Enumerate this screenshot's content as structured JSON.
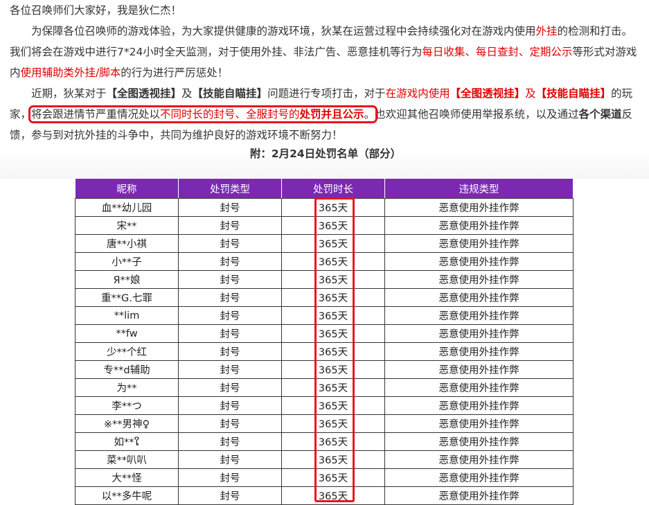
{
  "article": {
    "greeting": "各位召唤师们大家好，我是狄仁杰！",
    "p1_a": "为保障各位召唤师的游戏体验，为大家提供健康的游戏环境，狄某在运营过程中会持续强化对在游戏内使用",
    "p1_red1": "外挂",
    "p1_b": "的检测和打击。我们将会在游戏中进行7*24小时全天监测，对于使用外挂、非法广告、恶意挂机等行为",
    "p1_red2": "每日收集、每日查封、定期公示",
    "p1_c": "等形式对游戏内",
    "p1_red3": "使用辅助类外挂/脚本",
    "p1_d": "的行为进行严厉惩处！",
    "p2_a": "近期，狄某对于",
    "p2_b1": "【全图透视挂】",
    "p2_b": "及",
    "p2_b2": "【技能自瞄挂】",
    "p2_c": "问题进行专项打击，对于",
    "p2_red1": "在游戏内使用",
    "p2_rb1": "【全图透视挂】",
    "p2_red2": "及",
    "p2_rb2": "【技能自瞄挂】",
    "p2_d": "的玩家，",
    "box_a": "将会跟进情节严重情况处以",
    "box_red": "不同时长的封号、全服封号的",
    "box_bold": "处罚并且公示",
    "box_end": "。",
    "p2_e": "也欢迎其他召唤师使用举报系统，以及通过",
    "p2_bold": "各个渠道",
    "p2_f": "反馈，参与到对抗外挂的斗争中，共同为维护良好的游戏环境不断努力！",
    "caption": "附：2月24日处罚名单（部分）"
  },
  "table": {
    "headers": [
      "昵称",
      "处罚类型",
      "处罚时长",
      "违规类型"
    ],
    "rows": [
      [
        "血**幼儿园",
        "封号",
        "365天",
        "恶意使用外挂作弊"
      ],
      [
        "宋**",
        "封号",
        "365天",
        "恶意使用外挂作弊"
      ],
      [
        "唐**小祺",
        "封号",
        "365天",
        "恶意使用外挂作弊"
      ],
      [
        "小**子",
        "封号",
        "365天",
        "恶意使用外挂作弊"
      ],
      [
        "Я**娘",
        "封号",
        "365天",
        "恶意使用外挂作弊"
      ],
      [
        "重**G.七罪",
        "封号",
        "365天",
        "恶意使用外挂作弊"
      ],
      [
        "**lim",
        "封号",
        "365天",
        "恶意使用外挂作弊"
      ],
      [
        "**fw",
        "封号",
        "365天",
        "恶意使用外挂作弊"
      ],
      [
        "少**个红",
        "封号",
        "365天",
        "恶意使用外挂作弊"
      ],
      [
        "专**d辅助",
        "封号",
        "365天",
        "恶意使用外挂作弊"
      ],
      [
        "为**",
        "封号",
        "365天",
        "恶意使用外挂作弊"
      ],
      [
        "李**つ",
        "封号",
        "365天",
        "恶意使用外挂作弊"
      ],
      [
        "※**男神♀",
        "封号",
        "365天",
        "恶意使用外挂作弊"
      ],
      [
        "如**ໃ",
        "封号",
        "365天",
        "恶意使用外挂作弊"
      ],
      [
        "菜**叭叭",
        "封号",
        "365天",
        "恶意使用外挂作弊"
      ],
      [
        "大**怪",
        "封号",
        "365天",
        "恶意使用外挂作弊"
      ],
      [
        "以**多牛呢",
        "封号",
        "365天",
        "恶意使用外挂作弊"
      ]
    ]
  },
  "colors": {
    "header_bg": "#7b29b3",
    "highlight_red": "#e00000",
    "box_red": "#e8141c"
  }
}
